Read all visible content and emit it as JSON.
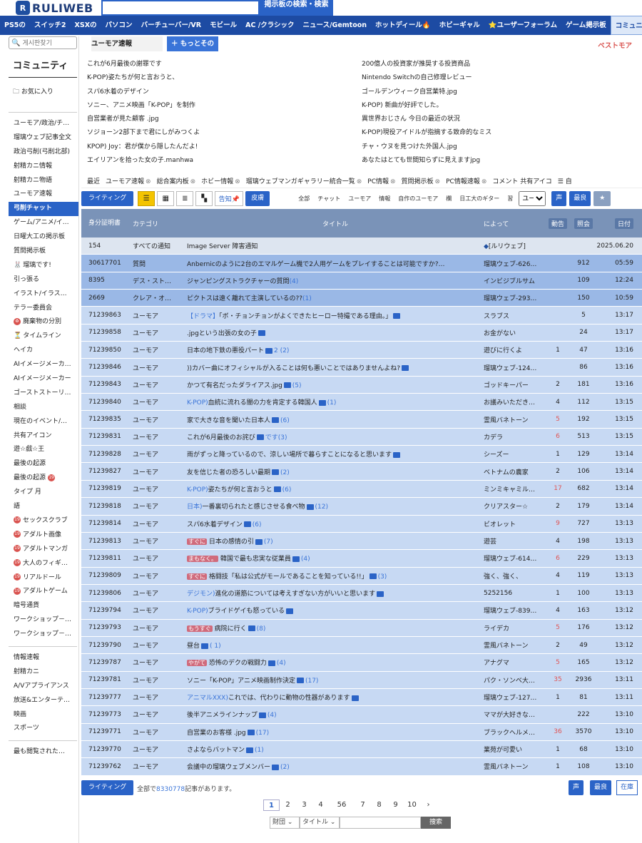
{
  "header": {
    "logo_mark": "R",
    "logo_text": "RULIWEB",
    "search_button": "掲示板の検索・検索"
  },
  "nav": [
    "PS5の",
    "スイッチ2",
    "XSXの",
    "パソコン",
    "バーチューバー/VR",
    "モビール",
    "AC /クラシック",
    "ニュース/Gemtoon",
    "ホットディール🔥",
    "ホビーギャル",
    "⭐ユーザーフォーラム",
    "ゲーム掲示板",
    "コミュニティ🐳",
    "最良"
  ],
  "sidebar": {
    "search_placeholder": "게시판찾기",
    "title": "コミュニティ",
    "favorites": "お気に入り",
    "items": [
      "ユーモア/政治/チ…",
      "瑠璃ウェブ記事全文",
      "政治弓削(弓削北部)",
      "射精カニ情報",
      "射精カニ物語",
      "ユーモア速報",
      "弓削チャット",
      "ゲーム/アニメ/イ…",
      "日曜大工の掲示板",
      "質問掲示板",
      "瑠璃です!",
      "引っ張る",
      "イラスト/イラス…",
      "テラー委員会",
      "廃棄物の分別",
      "タイムライン",
      "ヘイカ",
      "AIイメージメーカ…",
      "AIイメージメーカー",
      "ゴーストストーリ…",
      "相談",
      "現在のイベント/…",
      "共有アイコン",
      "遊☆戯☆王",
      "最後の起源",
      "最後の起源",
      "タイプ 月",
      "語",
      "セックスクラブ",
      "アダルト画像",
      "アダルトマンガ",
      "大人のフィギ…",
      "リアルドール",
      "アダルトゲーム",
      "暗号通貨",
      "ワークショップ－…",
      "ワークショップ－…"
    ],
    "items2": [
      "情報速報",
      "射精カニ",
      "A/Vアプライアンス",
      "放送&エンターテ…",
      "映画",
      "スポーツ"
    ],
    "items3": [
      "最も閲覧された…"
    ]
  },
  "tabs": {
    "humor": "ユーモア速報",
    "more": "＋ もっとその",
    "best": "ベストモア"
  },
  "best_left": [
    "これが6月最後の謝罪です",
    "K-POP)姿たちが何と言おうと、",
    "スパ6水着のデザイン",
    "ソニー、アニメ映画「K-POP」を制作",
    "自営業者が見た顧客 .jpg",
    "ソジョーン2部下まで君にしがみつくよ",
    "KPOP) Joy：君が僕から隠したんだよ!",
    "エイリアンを拾った女の子.manhwa"
  ],
  "best_right": [
    "200億人の投資家が推奨する投資商品",
    "Nintendo Switchの自己修理レビュー",
    "ゴールデンウィーク自営業特.jpg",
    "K-POP) 新曲が好評でした。",
    "異世界おじさん 今日の最近の状況",
    "K-POP)現役アイドルが指摘する致命的なミス",
    "チャ・ウヌを見つけた外国人.jpg",
    "あなたはとても世間知らずに見えますjpg"
  ],
  "catbar": [
    "最近",
    "ユーモア速報",
    "総合案内板",
    "ホビー情報",
    "瑠璃ウェブマンガギャラリー統合一覧",
    "PC情報",
    "質問掲示板",
    "PC情報速報",
    "コメント 共有アイコ"
  ],
  "toolbar": {
    "write": "ライティング",
    "notice": "告知📌",
    "skin": "皮膚",
    "filters": [
      "全部",
      "チャット",
      "ユーモア",
      "情報",
      "自作のユーモア",
      "欄",
      "日工大のギター",
      "習"
    ],
    "select": "ユー",
    "voice": "声",
    "best": "最良"
  },
  "table_head": {
    "id": "身分証明書",
    "cat": "カテゴリ",
    "title": "タイトル",
    "by": "によって",
    "vote": "動告",
    "hits": "照会",
    "date": "日付"
  },
  "rows": [
    {
      "t": "notice",
      "id": "154",
      "cat": "すべての通知",
      "title": "Image Server 障害通知",
      "by": "[ルリウェブ]",
      "vote": "",
      "hits": "",
      "date": "2025.06.20"
    },
    {
      "t": "hl",
      "id": "30617701",
      "cat": "質問",
      "title": "Anbernicのように2台のエマルゲーム機で2人用ゲームをプレイすることは可能ですか?…",
      "by": "瑠璃ウェブ-626…",
      "vote": "",
      "hits": "912",
      "date": "05:59"
    },
    {
      "t": "hl",
      "id": "8395",
      "cat": "デス・スト…",
      "title": "ジャンピングストラクチャーの質問",
      "cm": "(4)",
      "by": "インビジブルサム",
      "vote": "",
      "hits": "109",
      "date": "12:24"
    },
    {
      "t": "hl",
      "id": "2669",
      "cat": "クレア・オ…",
      "title": "ピクトスは遠く離れて主演しているの??",
      "cm": "(1)",
      "by": "瑠璃ウェブ-293…",
      "vote": "",
      "hits": "150",
      "date": "10:59"
    },
    {
      "id": "71239863",
      "cat": "ユーモア",
      "pre": "【ドラマ】",
      "title": "「ボ・チョンチョンがよくできたヒーロー特撮である理由。」",
      "by": "スラブス",
      "vote": "",
      "hits": "5",
      "date": "13:17"
    },
    {
      "id": "71239858",
      "cat": "ユーモア",
      "title": ".jpgという出張の女の子",
      "by": "お金がない",
      "vote": "",
      "hits": "24",
      "date": "13:17"
    },
    {
      "id": "71239850",
      "cat": "ユーモア",
      "title": "日本の地下鉄の悪役パート",
      "cm": "2 (2)",
      "by": "遊びに行くよ",
      "vote": "1",
      "hits": "47",
      "date": "13:16"
    },
    {
      "id": "71239846",
      "cat": "ユーモア",
      "title": "))カバー曲にオフィシャルが入ることは何も悪いことではありませんよね?",
      "by": "瑠璃ウェブ-124…",
      "vote": "",
      "hits": "86",
      "date": "13:16"
    },
    {
      "id": "71239843",
      "cat": "ユーモア",
      "title": "かつて有名だったダライアス.jpg",
      "cm": "(5)",
      "by": "ゴッドキーパー",
      "vote": "2",
      "hits": "181",
      "date": "13:16"
    },
    {
      "id": "71239840",
      "cat": "ユーモア",
      "pre": "K-POP)",
      "title": "血統に流れる闇の力を肯定する韓国人",
      "cm": "(1)",
      "by": "お議みいただき…",
      "vote": "4",
      "hits": "112",
      "date": "13:15"
    },
    {
      "id": "71239835",
      "cat": "ユーモア",
      "title": "家で大きな音を聞いた日本人",
      "cm": "(6)",
      "by": "霊風バネトーン",
      "vote": "5",
      "vr": "1",
      "hits": "192",
      "date": "13:15"
    },
    {
      "id": "71239831",
      "cat": "ユーモア",
      "title": "これが6月最後のお詫び",
      "cm": "です(3)",
      "by": "カデラ",
      "vote": "6",
      "vr": "1",
      "hits": "513",
      "date": "13:15"
    },
    {
      "id": "71239828",
      "cat": "ユーモア",
      "title": "雨がずっと降っているので、涼しい場所で暮らすことになると思います",
      "by": "シーズー",
      "vote": "1",
      "hits": "129",
      "date": "13:14"
    },
    {
      "id": "71239827",
      "cat": "ユーモア",
      "title": "友を信じた者の恐ろしい最期",
      "cm": "(2)",
      "by": "ベトナムの農家",
      "vote": "2",
      "hits": "106",
      "date": "13:14"
    },
    {
      "id": "71239819",
      "cat": "ユーモア",
      "pre": "K-POP)",
      "title": "姿たちが何と言おうと",
      "cm": "(6)",
      "by": "ミンミキャミル…",
      "vote": "17",
      "vr": "1",
      "hits": "682",
      "date": "13:14"
    },
    {
      "id": "71239818",
      "cat": "ユーモア",
      "pre": "日本)",
      "title": "一番裏切られたと感じさせる食べ物",
      "cm": "(12)",
      "by": "クリアスター☆",
      "vote": "2",
      "hits": "179",
      "date": "13:14"
    },
    {
      "id": "71239814",
      "cat": "ユーモア",
      "title": "スパ6水着デザイン",
      "cm": "(6)",
      "by": "ビオレット",
      "vote": "9",
      "vr": "1",
      "hits": "727",
      "date": "13:13"
    },
    {
      "id": "71239813",
      "cat": "ユーモア",
      "tag": "すぐに",
      "title": "日本の感情の引",
      "cm": "(7)",
      "by": "遊芸",
      "vote": "4",
      "hits": "198",
      "date": "13:13"
    },
    {
      "id": "71239811",
      "cat": "ユーモア",
      "tag": "まもなく。",
      "title": "韓国で最も忠実な従業員",
      "cm": "(4)",
      "by": "瑠璃ウェブ-614…",
      "vote": "6",
      "vr": "1",
      "hits": "229",
      "date": "13:13"
    },
    {
      "id": "71239809",
      "cat": "ユーモア",
      "tag": "すぐに",
      "title": "格闘技「私は公式がモールであることを知っている!!」",
      "cm": "(3)",
      "by": "強く、強く、",
      "vote": "4",
      "hits": "119",
      "date": "13:13"
    },
    {
      "id": "71239806",
      "cat": "ユーモア",
      "pre": "デジモン)",
      "title": "進化の道筋については考えすぎない方がいいと思います",
      "by": "5252156",
      "vote": "1",
      "hits": "100",
      "date": "13:13"
    },
    {
      "id": "71239794",
      "cat": "ユーモア",
      "pre": "K-POP)",
      "title": "ブライドゲイも怒っている",
      "by": "瑠璃ウェブ-839…",
      "vote": "4",
      "hits": "163",
      "date": "13:12"
    },
    {
      "id": "71239793",
      "cat": "ユーモア",
      "tag": "もうすぐ",
      "title": "病院に行く",
      "cm": "(8)",
      "by": "ライデカ",
      "vote": "5",
      "vr": "1",
      "hits": "176",
      "date": "13:12"
    },
    {
      "id": "71239790",
      "cat": "ユーモア",
      "title": "昼台",
      "cm": "( 1)",
      "by": "霊風バネトーン",
      "vote": "2",
      "hits": "49",
      "date": "13:12"
    },
    {
      "id": "71239787",
      "cat": "ユーモア",
      "tag": "やがて",
      "title": "恐怖のデクの戦闘力",
      "cm": "(4)",
      "by": "アナグマ",
      "vote": "5",
      "vr": "1",
      "hits": "165",
      "date": "13:12"
    },
    {
      "id": "71239781",
      "cat": "ユーモア",
      "title": "ソニー「K-POP」アニメ映画制作決定",
      "cm": "(17)",
      "by": "パク・ソンベ大…",
      "vote": "35",
      "vr": "1",
      "hits": "2936",
      "date": "13:11"
    },
    {
      "id": "71239777",
      "cat": "ユーモア",
      "pre": "アニマルXXX)",
      "title": "これでは、代わりに動物の性器があります",
      "by": "瑠璃ウェブ-127…",
      "vote": "1",
      "hits": "81",
      "date": "13:11"
    },
    {
      "id": "71239773",
      "cat": "ユーモア",
      "title": "後半アニメラインナップ",
      "cm": "(4)",
      "by": "ママが大好きな…",
      "vote": "",
      "hits": "222",
      "date": "13:10"
    },
    {
      "id": "71239771",
      "cat": "ユーモア",
      "title": "自営業のお客様 .jpg",
      "cm": "(17)",
      "by": "ブラックヘルメ…",
      "vote": "36",
      "vr": "1",
      "hits": "3570",
      "date": "13:10"
    },
    {
      "id": "71239770",
      "cat": "ユーモア",
      "title": "さよならバットマン",
      "cm": "(1)",
      "by": "業苑が可愛い",
      "vote": "1",
      "hits": "68",
      "date": "13:10"
    },
    {
      "id": "71239762",
      "cat": "ユーモア",
      "title": "会議中の瑠璃ウェブメンバー",
      "cm": "(2)",
      "by": "霊風バネトーン",
      "vote": "1",
      "hits": "108",
      "date": "13:10"
    }
  ],
  "footer": {
    "write": "ライティング",
    "count_prefix": "全部で",
    "count": "8330778",
    "count_suffix": "記事があります。",
    "voice": "声",
    "best": "最良",
    "stock": "在庫"
  },
  "pager": [
    "1",
    "2",
    "3",
    "4",
    "56",
    "7",
    "8",
    "9",
    "10",
    "›"
  ],
  "bottom_search": {
    "sel1": "財団",
    "sel2": "タイトル",
    "go": "捜索"
  }
}
